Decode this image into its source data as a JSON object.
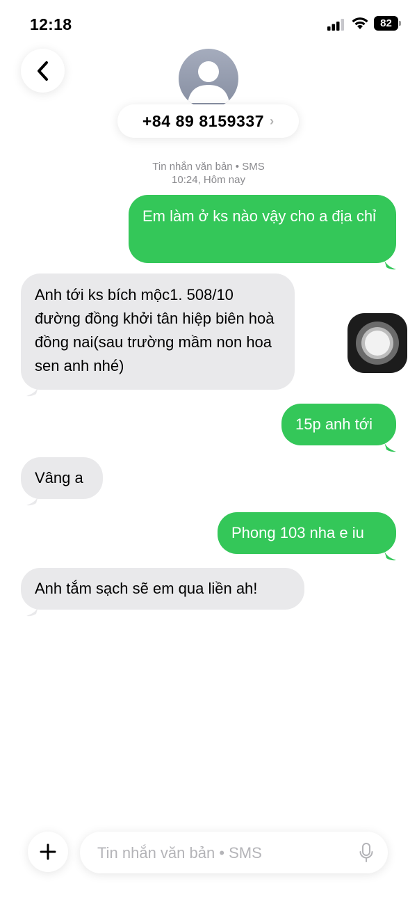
{
  "status_bar": {
    "time": "12:18",
    "battery_level": "82",
    "icons": [
      "signal-icon",
      "wifi-icon",
      "battery-icon"
    ]
  },
  "header": {
    "back_icon": "chevron-left-icon",
    "avatar_icon": "person-avatar-icon",
    "contact_number": "+84 89 8159337",
    "contact_chevron": "›"
  },
  "thread_meta": {
    "channel": "Tin nhắn văn bản • SMS",
    "timestamp": "10:24, Hôm nay"
  },
  "messages": [
    {
      "direction": "outgoing",
      "text": "Em làm ở ks nào vậy cho a địa chỉ"
    },
    {
      "direction": "incoming",
      "text": "Anh tới ks bích mộc1.  508/10 đường đồng khởi tân hiệp biên hoà đồng nai(sau trường mầm non hoa sen anh nhé)"
    },
    {
      "direction": "outgoing",
      "text": "15p anh tới"
    },
    {
      "direction": "incoming",
      "text": "Vâng a"
    },
    {
      "direction": "outgoing",
      "text": "Phong 103 nha e iu"
    },
    {
      "direction": "incoming",
      "text": "Anh tắm sạch sẽ em qua liền ah!"
    }
  ],
  "composer": {
    "plus_icon": "plus-icon",
    "placeholder": "Tin nhắn văn bản • SMS",
    "mic_icon": "microphone-icon"
  },
  "colors": {
    "outgoing_bubble": "#34c759",
    "incoming_bubble": "#e9e9eb",
    "meta_text": "#8a8a8e",
    "placeholder_text": "#b4b4b8"
  }
}
